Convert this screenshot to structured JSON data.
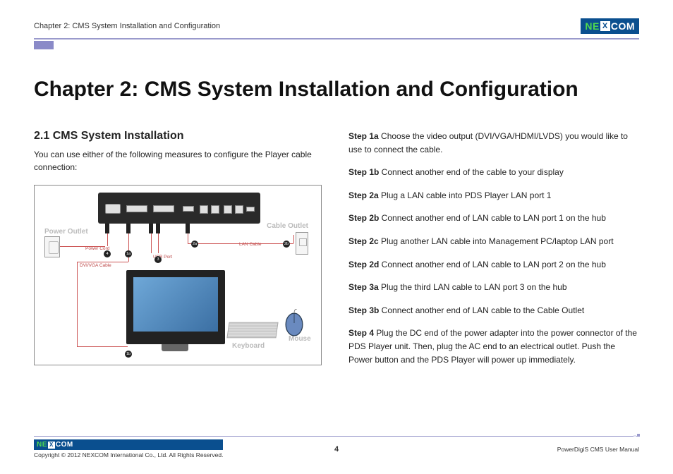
{
  "header": {
    "breadcrumb": "Chapter 2: CMS System Installation and Configuration",
    "logo_text_left": "NE",
    "logo_text_x": "X",
    "logo_text_right": "COM"
  },
  "title": "Chapter 2: CMS System Installation and Configuration",
  "section": {
    "heading": "2.1 CMS System Installation",
    "intro": "You can use either of the following measures to configure the Player cable connection:"
  },
  "diagram_labels": {
    "power_outlet": "Power Outlet",
    "cable_outlet": "Cable Outlet",
    "power_cord": "Power Cord",
    "usb_port": "USB Port",
    "lan_cable": "LAN Cable",
    "dvi_vga_cable": "DVI/VGA Cable",
    "keyboard": "Keyboard",
    "mouse": "Mouse",
    "b1a": "1a",
    "b1b": "1b",
    "b2a": "2a",
    "b2b": "2b",
    "b3": "3",
    "b4": "4"
  },
  "steps": {
    "s1a_label": "Step 1a",
    "s1a_text": " Choose the video output (DVI/VGA/HDMI/LVDS) you would like to use to connect the cable.",
    "s1b_label": "Step 1b",
    "s1b_text": " Connect another end of the cable to your display",
    "s2a_label": "Step 2a",
    "s2a_text": " Plug a LAN cable into PDS Player LAN port 1",
    "s2b_label": "Step 2b",
    "s2b_text": " Connect another end of LAN cable to LAN port 1 on the hub",
    "s2c_label": "Step 2c",
    "s2c_text": " Plug another LAN cable into Management PC/laptop LAN port",
    "s2d_label": "Step 2d",
    "s2d_text": " Connect another end of LAN cable to LAN port 2 on the hub",
    "s3a_label": "Step 3a",
    "s3a_text": " Plug the third LAN cable to LAN port 3 on the hub",
    "s3b_label": "Step 3b",
    "s3b_text": " Connect another end of LAN cable to the Cable Outlet",
    "s4_label": "Step 4",
    "s4_text": " Plug the DC end of the power adapter into the power connector of the PDS Player unit. Then, plug the AC end to an electrical outlet. Push the Power button and the PDS Player will power up immediately."
  },
  "footer": {
    "copyright": "Copyright © 2012 NEXCOM International Co., Ltd. All Rights Reserved.",
    "page_number": "4",
    "doc_title": "PowerDigiS CMS User Manual"
  }
}
